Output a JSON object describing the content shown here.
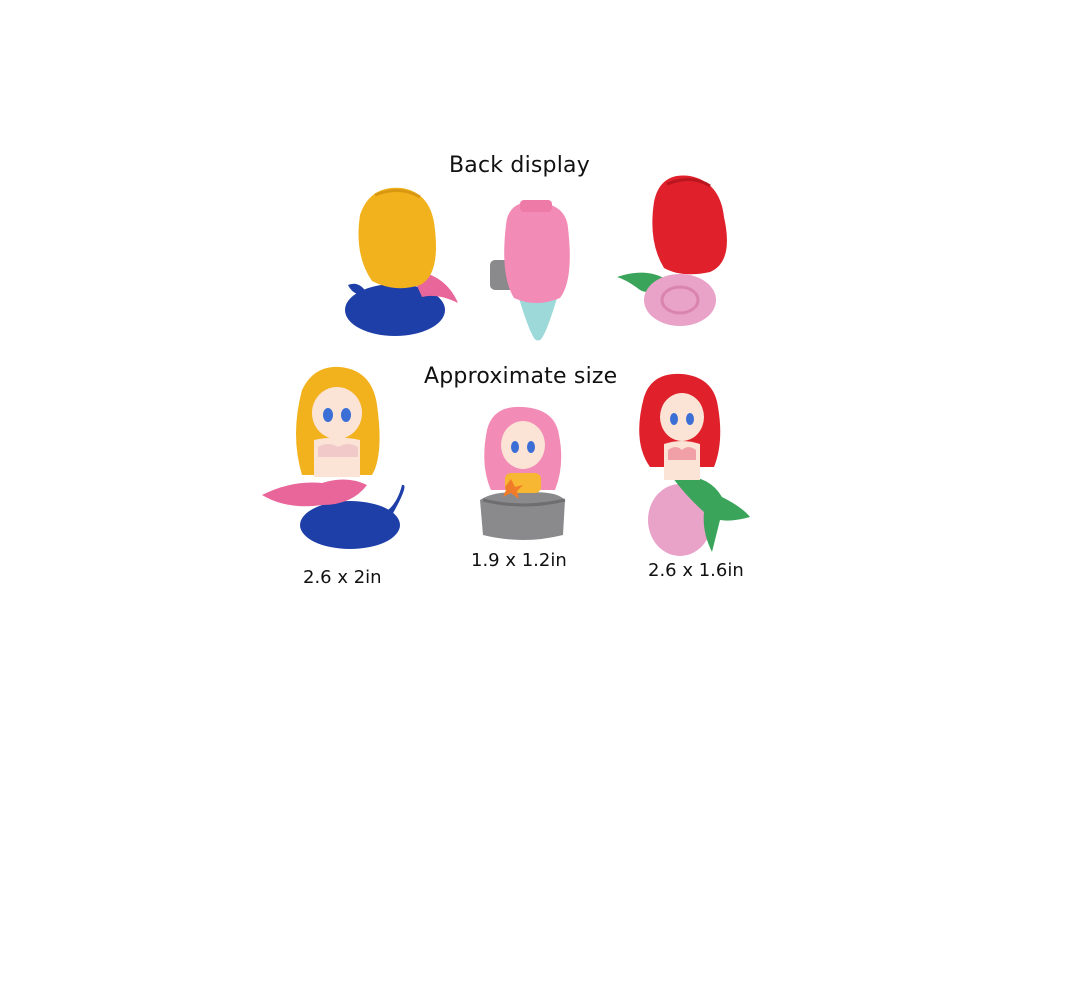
{
  "headings": {
    "back": "Back display",
    "size": "Approximate size"
  },
  "figures": [
    {
      "name": "yellow-hair mermaid on blue whale",
      "size": "2.6 x 2in",
      "hair": "#f2b21d",
      "tail": "#e9669a",
      "base": "#1f3fa8"
    },
    {
      "name": "pink-hair mermaid on grey rock",
      "size": "1.9 x 1.2in",
      "hair": "#f28bb6",
      "tail": "#9ed9d9",
      "base": "#8a8a8c"
    },
    {
      "name": "red-hair mermaid on pink shell",
      "size": "2.6 x 1.6in",
      "hair": "#e0202a",
      "tail": "#3aa55a",
      "base": "#e9a2c8"
    }
  ]
}
